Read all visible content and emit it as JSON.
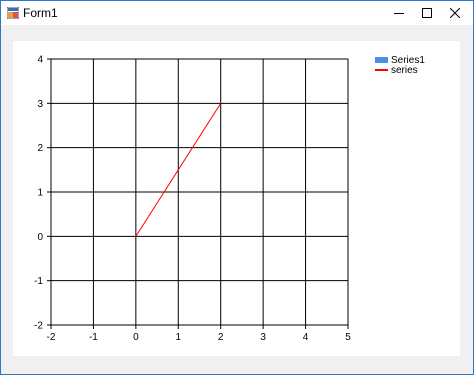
{
  "window": {
    "title": "Form1"
  },
  "icons": {
    "app": "winforms-app-icon",
    "minimize": "minimize-icon",
    "maximize": "maximize-icon",
    "close": "close-icon"
  },
  "chart_data": {
    "type": "line",
    "xlim": [
      -2,
      5
    ],
    "ylim": [
      -2,
      4
    ],
    "x_ticks": [
      "-2",
      "-1",
      "0",
      "1",
      "2",
      "3",
      "4",
      "5"
    ],
    "y_ticks": [
      "4",
      "3",
      "2",
      "1",
      "0",
      "-1",
      "-2"
    ],
    "grid": true,
    "legend_position": "top-right",
    "legend": [
      {
        "name": "Series1",
        "kind": "box",
        "color": "#4a8fe7"
      },
      {
        "name": "series",
        "kind": "line",
        "color": "#ff0000"
      }
    ],
    "series": [
      {
        "name": "Series1",
        "points": []
      },
      {
        "name": "series",
        "color": "#ff0000",
        "points": [
          [
            0,
            0
          ],
          [
            2,
            3
          ]
        ]
      }
    ]
  }
}
